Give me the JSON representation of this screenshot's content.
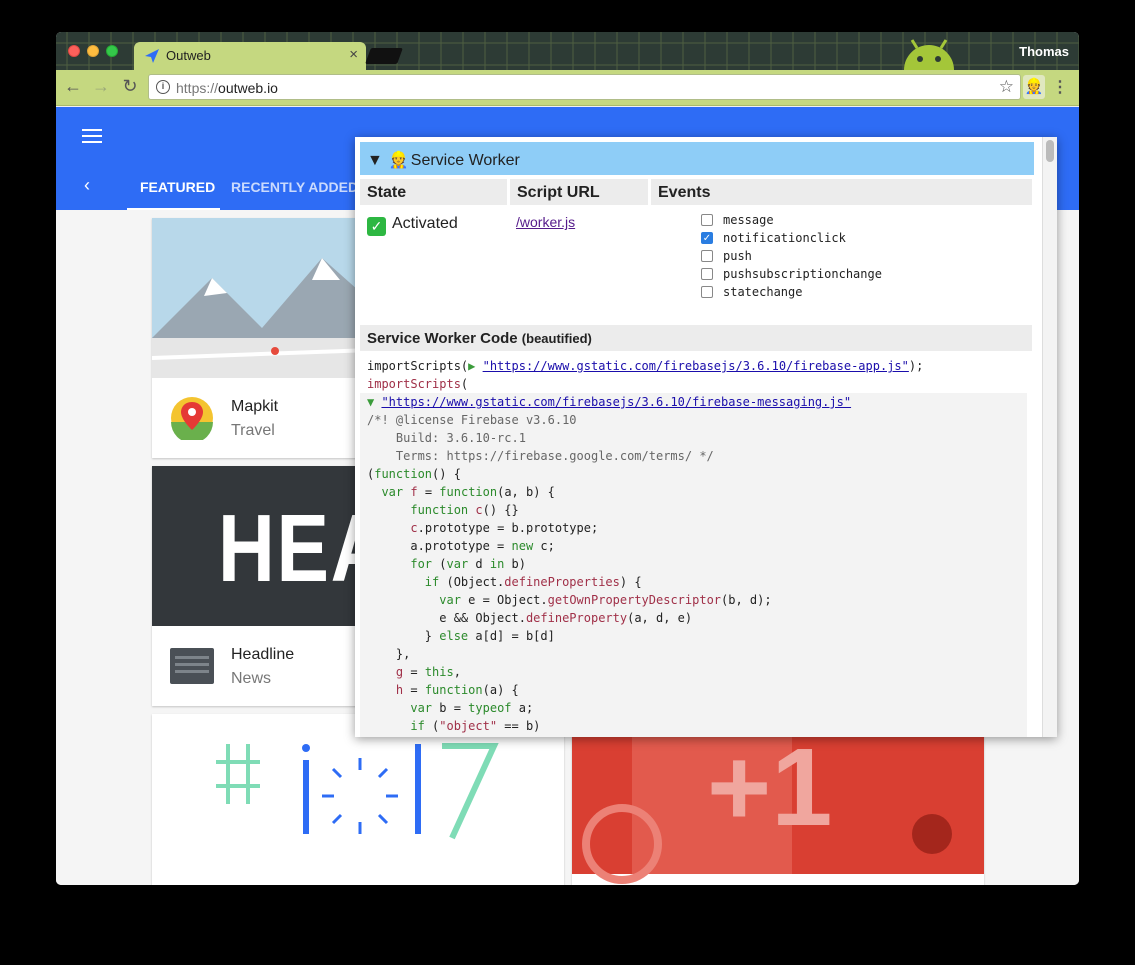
{
  "browser": {
    "tab_title": "Outweb",
    "tab_close": "×",
    "profile_name": "Thomas",
    "url_scheme": "https://",
    "url_host": "outweb.io",
    "back_glyph": "←",
    "forward_glyph": "→",
    "reload_glyph": "↻",
    "info_glyph": "i",
    "star_glyph": "☆",
    "ext_glyph": "👷",
    "menu_glyph": "⋮"
  },
  "app": {
    "accent": "#2e6cf5",
    "tabs_back_glyph": "‹",
    "tabs": [
      "FEATURED",
      "RECENTLY ADDED"
    ]
  },
  "cards": [
    {
      "title": "Mapkit",
      "subtitle": "Travel"
    },
    {
      "title": "Headline",
      "subtitle": "News"
    }
  ],
  "headline_banner": "HEAD",
  "plus_banner": "+1",
  "popup": {
    "header_toggle": "▼",
    "header_icon": "👷",
    "header_title": "Service Worker",
    "columns": {
      "state": "State",
      "script": "Script URL",
      "events": "Events"
    },
    "state_check": "✓",
    "state_value": "Activated",
    "script_url": "/worker.js",
    "events": [
      {
        "name": "message",
        "checked": false
      },
      {
        "name": "notificationclick",
        "checked": true
      },
      {
        "name": "push",
        "checked": false
      },
      {
        "name": "pushsubscriptionchange",
        "checked": false
      },
      {
        "name": "statechange",
        "checked": false
      }
    ],
    "check_glyph": "✓",
    "code_title": "Service Worker Code",
    "code_subtitle": "(beautified)",
    "import_1": "\"https://www.gstatic.com/firebasejs/3.6.10/firebase-app.js\"",
    "import_2": "\"https://www.gstatic.com/firebasejs/3.6.10/firebase-messaging.js\""
  }
}
